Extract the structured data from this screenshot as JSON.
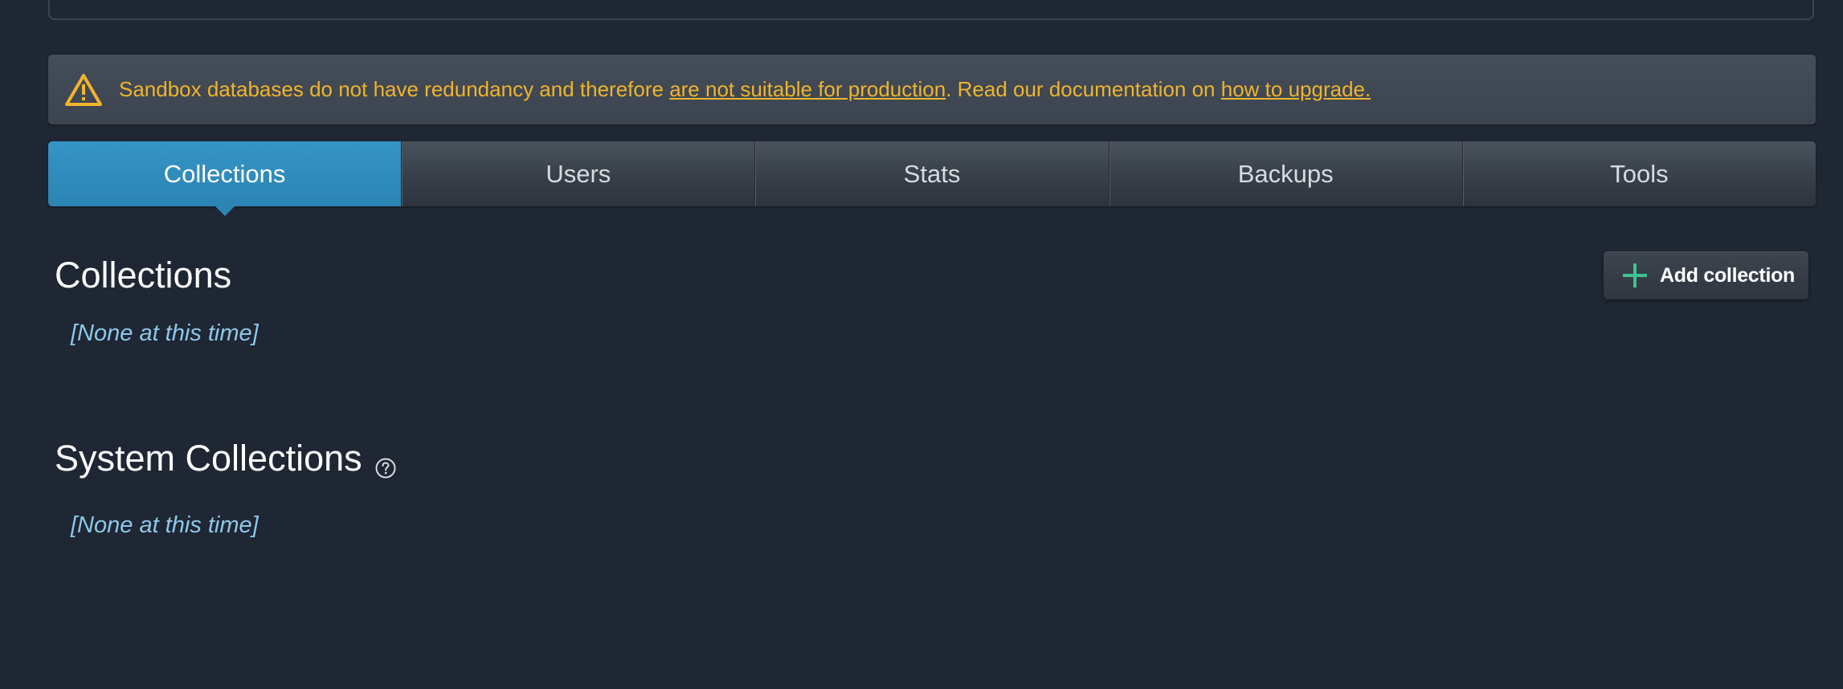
{
  "alert": {
    "icon": "warning-icon",
    "text_before": "Sandbox databases do not have redundancy and therefore ",
    "link1": "are not suitable for production",
    "text_middle": ". Read our documentation on ",
    "link2": "how to upgrade.",
    "color": "#f0b42c"
  },
  "tabs": [
    {
      "label": "Collections",
      "active": true
    },
    {
      "label": "Users",
      "active": false
    },
    {
      "label": "Stats",
      "active": false
    },
    {
      "label": "Backups",
      "active": false
    },
    {
      "label": "Tools",
      "active": false
    }
  ],
  "collections": {
    "title": "Collections",
    "empty_text": "[None at this time]",
    "add_button_label": "Add collection",
    "add_icon": "plus-icon"
  },
  "system_collections": {
    "title": "System Collections",
    "help_icon": "help-icon",
    "empty_text": "[None at this time]"
  },
  "colors": {
    "background": "#1e2733",
    "active_tab": "#2c84b4",
    "empty_text": "#8ec7ea",
    "plus_icon": "#3fc191"
  }
}
